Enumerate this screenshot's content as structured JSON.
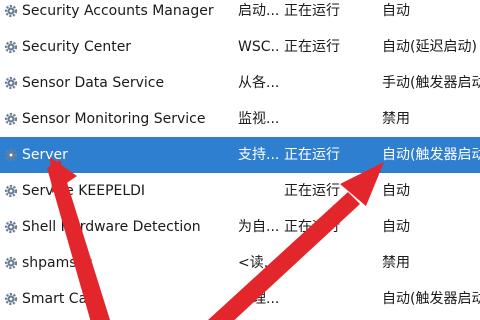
{
  "services": [
    {
      "name": "Security Accounts Manager",
      "description": "启动...",
      "status": "正在运行",
      "startup": "自动",
      "selected": false
    },
    {
      "name": "Security Center",
      "description": "WSC...",
      "status": "正在运行",
      "startup": "自动(延迟启动)",
      "selected": false
    },
    {
      "name": "Sensor Data Service",
      "description": "从各...",
      "status": "",
      "startup": "手动(触发器启动)",
      "selected": false
    },
    {
      "name": "Sensor Monitoring Service",
      "description": "监视...",
      "status": "",
      "startup": "禁用",
      "selected": false
    },
    {
      "name": "Server",
      "description": "支持...",
      "status": "正在运行",
      "startup": "自动(触发器启动)",
      "selected": true
    },
    {
      "name": "Service KEEPELDI",
      "description": "",
      "status": "正在运行",
      "startup": "自动",
      "selected": false
    },
    {
      "name": "Shell Hardware Detection",
      "description": "为自...",
      "status": "正在运行",
      "startup": "自动",
      "selected": false
    },
    {
      "name": "shpamsvc",
      "description": "<读...",
      "status": "",
      "startup": "禁用",
      "selected": false
    },
    {
      "name": "Smart Card",
      "description": "管理...",
      "status": "",
      "startup": "自动(触发器启动)",
      "selected": false
    }
  ],
  "colors": {
    "selection": "#2f7fd1",
    "gear": "#6a7f96",
    "annotation_arrow": "#e3262b"
  }
}
